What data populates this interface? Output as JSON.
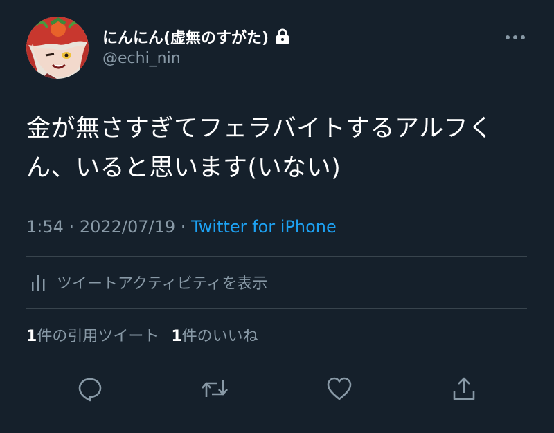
{
  "user": {
    "display_name": "にんにん(虚無のすがた)",
    "handle": "@echi_nin",
    "protected": true
  },
  "tweet": {
    "text": "金が無さすぎてフェラバイトするアルフくん、いると思います(いない)",
    "time": "1:54",
    "separator": "·",
    "date": "2022/07/19",
    "source": "Twitter for iPhone"
  },
  "activity": {
    "label": "ツイートアクティビティを表示"
  },
  "stats": {
    "quote_count": "1",
    "quote_label": "件の引用ツイート",
    "like_count": "1",
    "like_label": "件のいいね"
  },
  "colors": {
    "background": "#15202b",
    "text": "#ffffff",
    "secondary": "#8899a6",
    "accent": "#1da1f2",
    "divider": "#38444d"
  },
  "icons": {
    "more": "more-dots-icon",
    "lock": "lock-icon",
    "activity": "bar-chart-icon",
    "reply": "reply-icon",
    "retweet": "retweet-icon",
    "like": "heart-icon",
    "share": "share-icon"
  }
}
